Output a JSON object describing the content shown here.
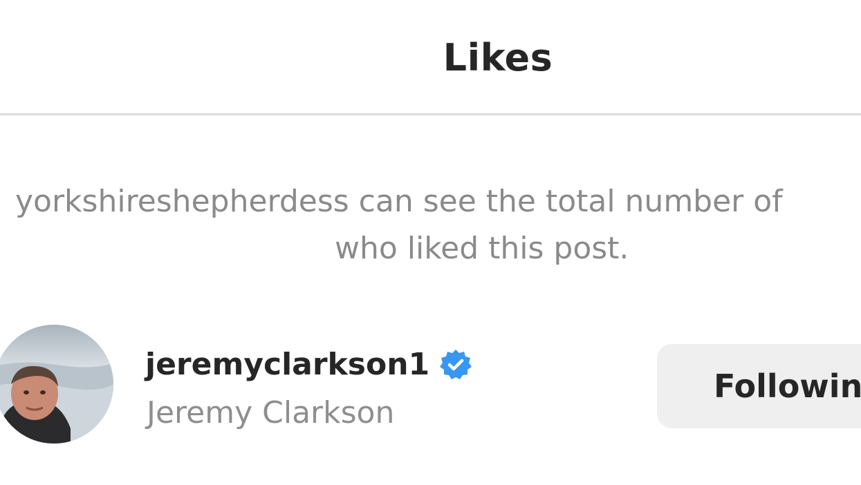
{
  "header": {
    "title": "Likes"
  },
  "notice": {
    "line1": "yorkshireshepherdess can see the total number of",
    "line2": "who liked this post."
  },
  "likes": [
    {
      "username": "jeremyclarkson1",
      "verified": true,
      "full_name": "Jeremy Clarkson",
      "action_label": "Followin"
    }
  ],
  "colors": {
    "verified_badge": "#3897f0",
    "secondary_text": "#8e8e8e",
    "primary_text": "#262626",
    "button_bg": "#efefef",
    "divider": "#dbdbdb"
  },
  "icons": {
    "verified": "verified-badge-icon"
  }
}
